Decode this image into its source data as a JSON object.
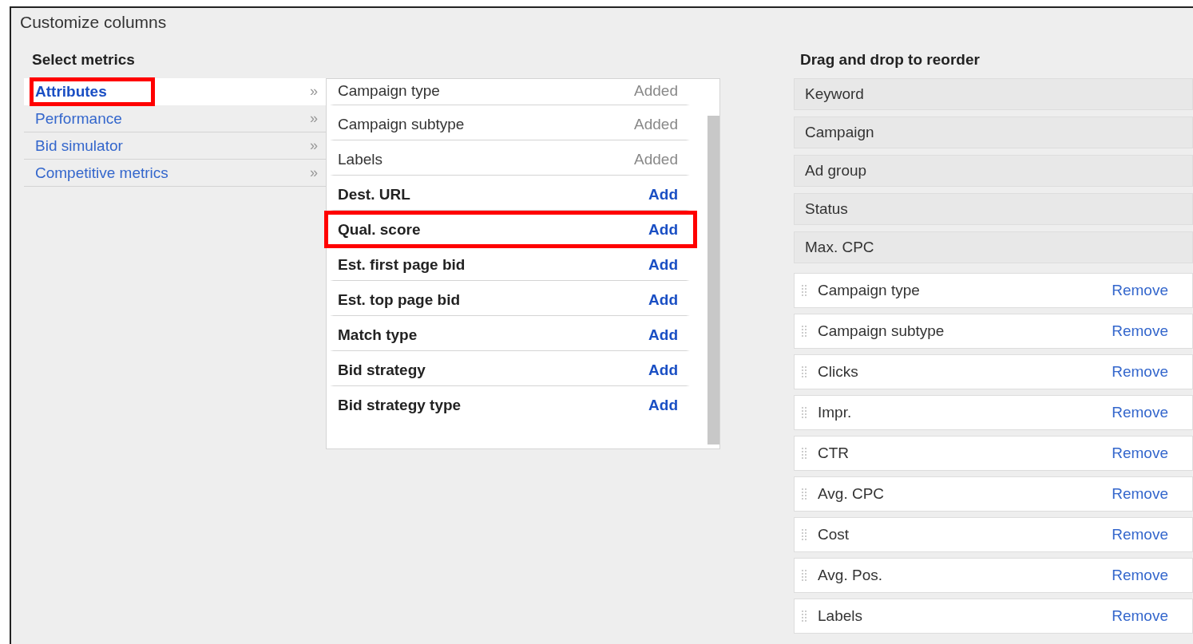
{
  "window": {
    "title": "Customize columns"
  },
  "select_metrics": {
    "heading": "Select metrics",
    "categories": [
      {
        "label": "Attributes",
        "selected": true,
        "highlighted": true
      },
      {
        "label": "Performance",
        "selected": false,
        "highlighted": false
      },
      {
        "label": "Bid simulator",
        "selected": false,
        "highlighted": false
      },
      {
        "label": "Competitive metrics",
        "selected": false,
        "highlighted": false
      }
    ],
    "chevron": "»",
    "metrics": [
      {
        "label": "Campaign type",
        "kind": "added",
        "action": "Added",
        "highlighted": false
      },
      {
        "label": "Campaign subtype",
        "kind": "added",
        "action": "Added",
        "highlighted": false
      },
      {
        "label": "Labels",
        "kind": "added",
        "action": "Added",
        "highlighted": false
      },
      {
        "label": "Dest. URL",
        "kind": "addable",
        "action": "Add",
        "highlighted": false
      },
      {
        "label": "Qual. score",
        "kind": "addable",
        "action": "Add",
        "highlighted": true
      },
      {
        "label": "Est. first page bid",
        "kind": "addable",
        "action": "Add",
        "highlighted": false
      },
      {
        "label": "Est. top page bid",
        "kind": "addable",
        "action": "Add",
        "highlighted": false
      },
      {
        "label": "Match type",
        "kind": "addable",
        "action": "Add",
        "highlighted": false
      },
      {
        "label": "Bid strategy",
        "kind": "addable",
        "action": "Add",
        "highlighted": false
      },
      {
        "label": "Bid strategy type",
        "kind": "addable",
        "action": "Add",
        "highlighted": false
      }
    ]
  },
  "reorder": {
    "heading": "Drag and drop to reorder",
    "fixed_columns": [
      "Keyword",
      "Campaign",
      "Ad group",
      "Status",
      "Max. CPC"
    ],
    "columns": [
      {
        "label": "Campaign type",
        "action": "Remove"
      },
      {
        "label": "Campaign subtype",
        "action": "Remove"
      },
      {
        "label": "Clicks",
        "action": "Remove"
      },
      {
        "label": "Impr.",
        "action": "Remove"
      },
      {
        "label": "CTR",
        "action": "Remove"
      },
      {
        "label": "Avg. CPC",
        "action": "Remove"
      },
      {
        "label": "Cost",
        "action": "Remove"
      },
      {
        "label": "Avg. Pos.",
        "action": "Remove"
      },
      {
        "label": "Labels",
        "action": "Remove"
      }
    ]
  }
}
